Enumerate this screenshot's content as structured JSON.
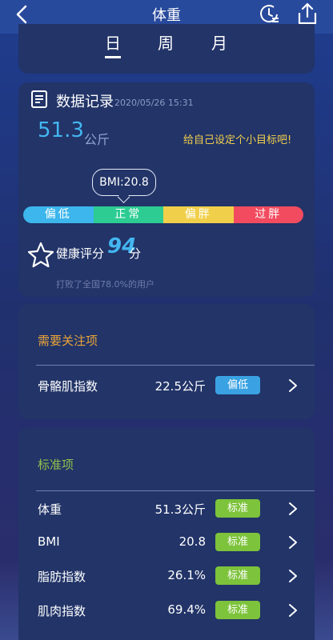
{
  "header": {
    "title": "体重",
    "back_icon": "chevron-left-icon",
    "history_icon": "clock-history-icon",
    "share_icon": "share-icon"
  },
  "tabs": [
    {
      "label": "日",
      "active": true
    },
    {
      "label": "周",
      "active": false
    },
    {
      "label": "月",
      "active": false
    }
  ],
  "record": {
    "title": "数据记录",
    "timestamp": "2020/05/26 15:31",
    "weight_value": "51.3",
    "weight_unit": "公斤",
    "goal_link": "给自己设定个小目标吧!",
    "bmi_bubble": "BMI:20.8",
    "bmi_segments": [
      "偏低",
      "正常",
      "偏胖",
      "过胖"
    ],
    "score_label": "健康评分",
    "score_value": "94",
    "score_unit": "分",
    "rank_text": "打败了全国78.0%的用户"
  },
  "attention": {
    "title": "需要关注项",
    "items": [
      {
        "name": "骨骼肌指数",
        "value": "22.5公斤",
        "badge": "偏低"
      }
    ]
  },
  "standard": {
    "title": "标准项",
    "items": [
      {
        "name": "体重",
        "value": "51.3公斤",
        "badge": "标准"
      },
      {
        "name": "BMI",
        "value": "20.8",
        "badge": "标准"
      },
      {
        "name": "脂肪指数",
        "value": "26.1%",
        "badge": "标准"
      },
      {
        "name": "肌肉指数",
        "value": "69.4%",
        "badge": "标准"
      }
    ]
  },
  "colors": {
    "accent": "#43b6f0",
    "low": "#3cb6ec",
    "normal": "#2ccc93",
    "fat": "#f0d04a",
    "over": "#f24b5f",
    "attention_title": "#e9a43a",
    "standard_title": "#8fc14a",
    "goal": "#f2cf4b"
  }
}
